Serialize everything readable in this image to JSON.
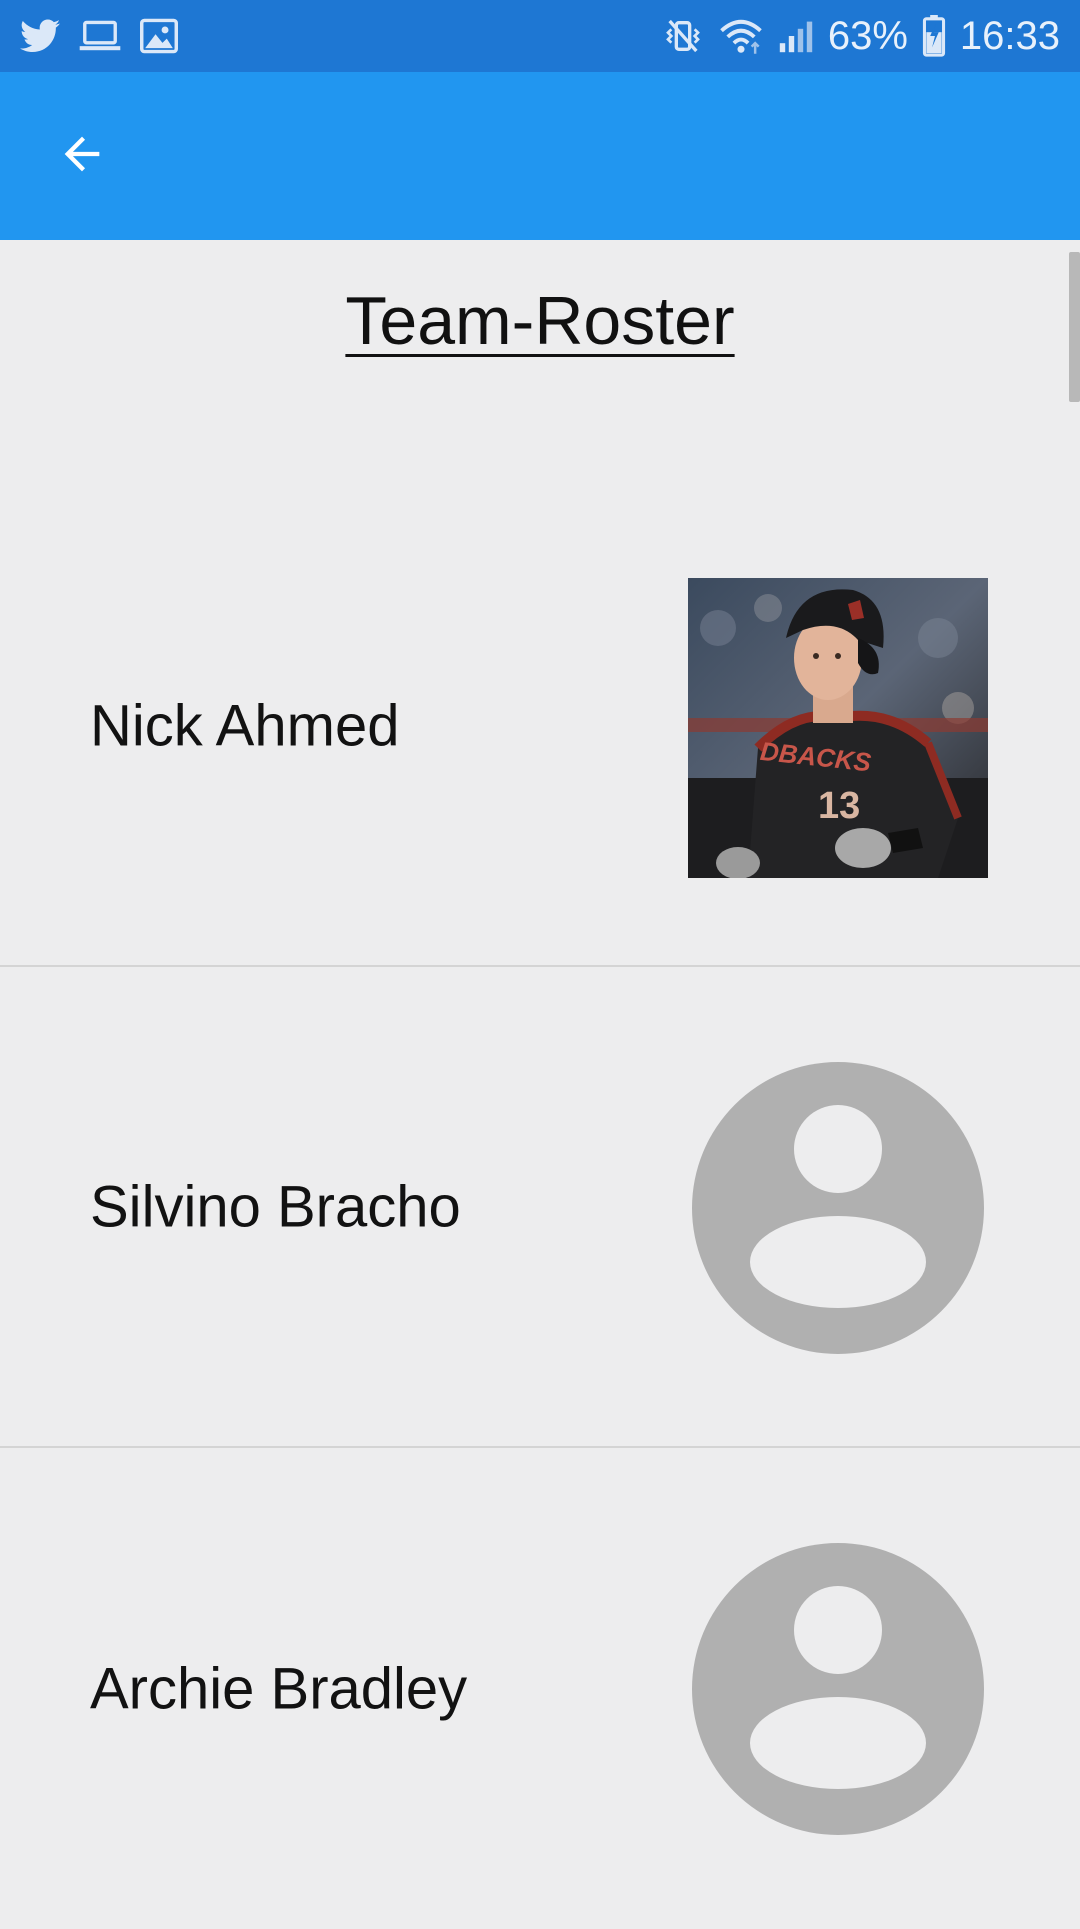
{
  "status_bar": {
    "battery": "63%",
    "time": "16:33",
    "left_icons": [
      "twitter-icon",
      "laptop-icon",
      "image-icon"
    ],
    "right_icons": [
      "vibrate-icon",
      "wifi-icon",
      "signal-icon",
      "battery-icon"
    ]
  },
  "app_bar": {
    "color": "#2196f0",
    "back_icon": "arrow-left-icon"
  },
  "page": {
    "title": "Team-Roster"
  },
  "roster": [
    {
      "name": "Nick Ahmed",
      "photo": "player-photo",
      "jersey_text": "DBACKS 13"
    },
    {
      "name": "Silvino Bracho",
      "photo": "avatar-placeholder"
    },
    {
      "name": "Archie Bradley",
      "photo": "avatar-placeholder"
    }
  ],
  "colors": {
    "status_bar": "#1e77d3",
    "app_bar": "#2196f0",
    "background": "#ededee",
    "placeholder": "#b0b0b0"
  }
}
